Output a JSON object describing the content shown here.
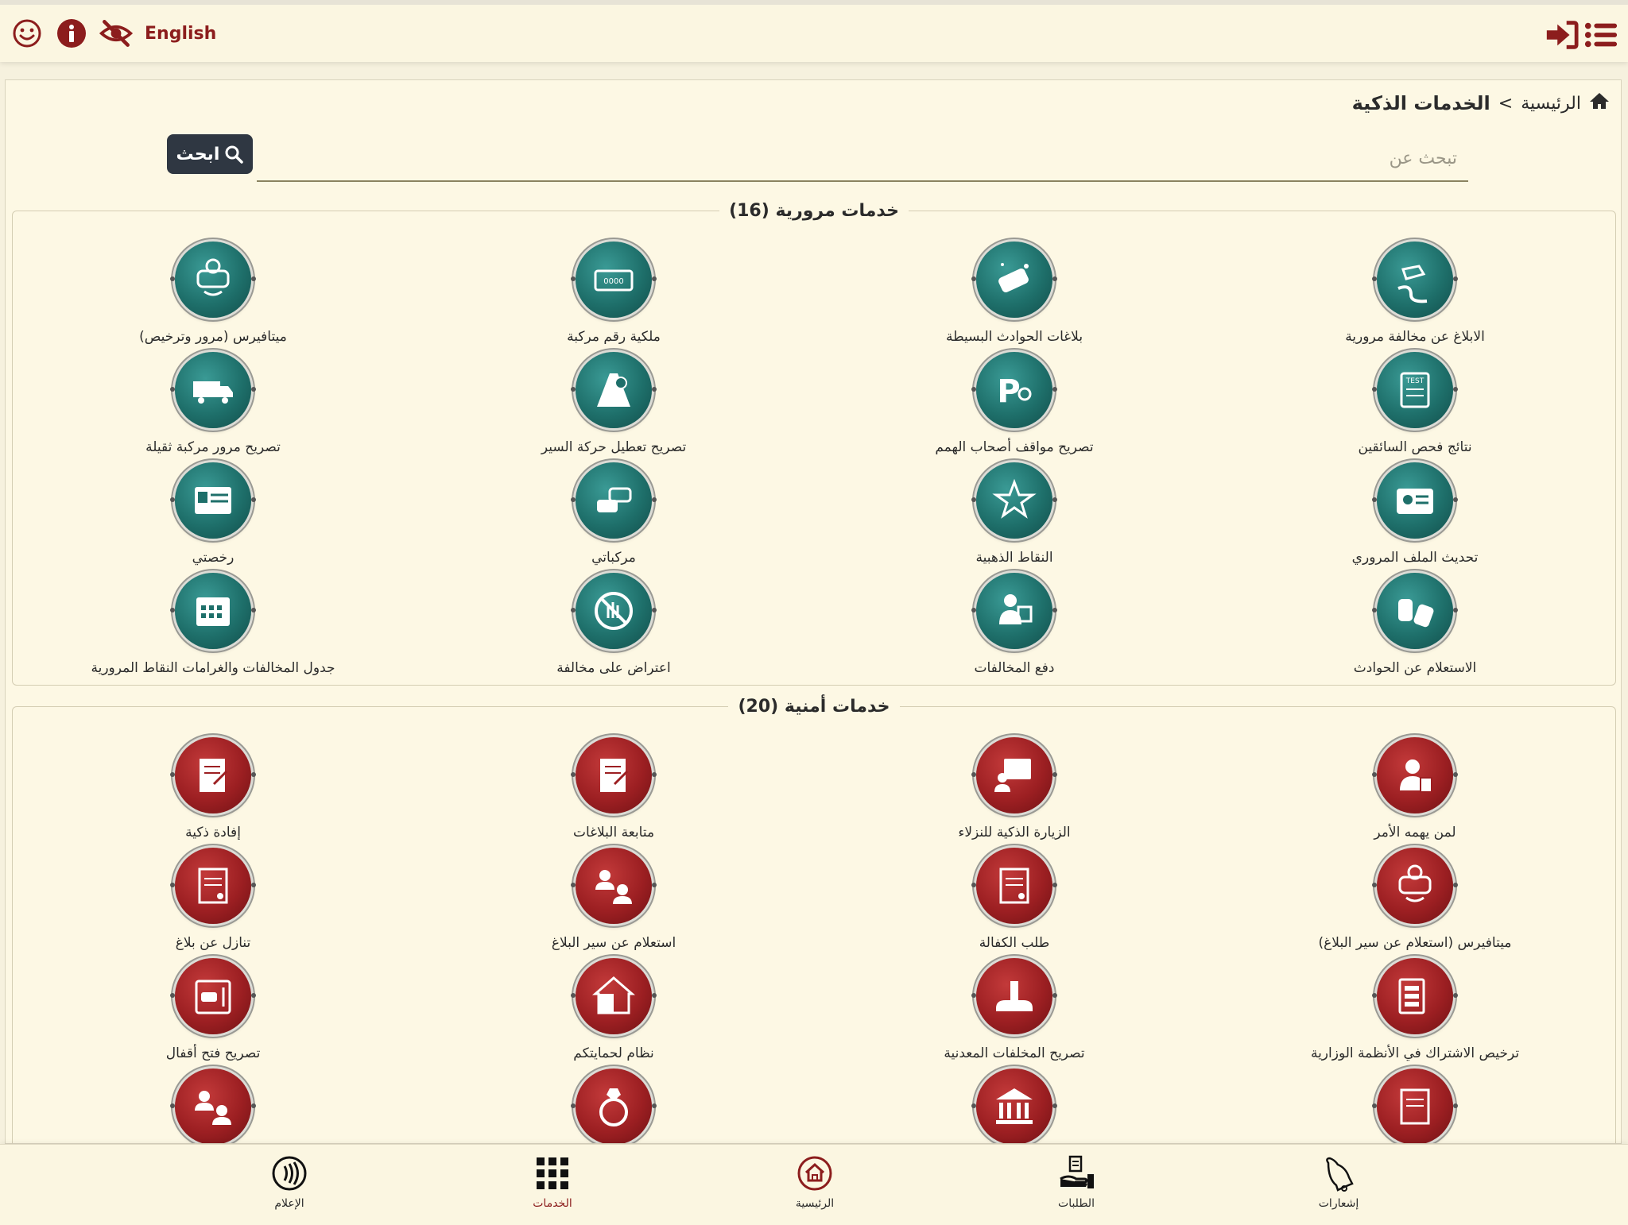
{
  "topbar": {
    "language_label": "English",
    "icons": [
      "smiley-icon",
      "info-icon",
      "eye-slash-icon",
      "logout-icon",
      "menu-icon"
    ]
  },
  "breadcrumb": {
    "home_label": "الرئيسية",
    "separator": ">",
    "current_label": "الخدمات الذكية"
  },
  "search": {
    "placeholder": "تبحث عن",
    "button_label": "ابحث"
  },
  "sections": [
    {
      "title": "خدمات مرورية (16)",
      "color": "#1e6f6a",
      "items": [
        {
          "label": "الابلاغ عن مخالفة مرورية",
          "icon": "car-swerve-icon"
        },
        {
          "label": "بلاغات الحوادث البسيطة",
          "icon": "car-crash-icon"
        },
        {
          "label": "ملكية رقم مركبة",
          "icon": "license-plate-icon"
        },
        {
          "label": "ميتافيرس (مرور وترخيص)",
          "icon": "vr-headset-icon"
        },
        {
          "label": "نتائج فحص السائقين",
          "icon": "test-sheet-icon"
        },
        {
          "label": "تصريح مواقف أصحاب الهمم",
          "icon": "accessible-parking-icon"
        },
        {
          "label": "تصريح تعطيل حركة السير",
          "icon": "road-block-icon"
        },
        {
          "label": "تصريح مرور مركبة ثقيلة",
          "icon": "truck-icon"
        },
        {
          "label": "تحديث الملف المروري",
          "icon": "id-card-icon"
        },
        {
          "label": "النقاط الذهبية",
          "icon": "star-badge-icon"
        },
        {
          "label": "مركباتي",
          "icon": "cars-icon"
        },
        {
          "label": "رخصتي",
          "icon": "driving-license-icon"
        },
        {
          "label": "الاستعلام عن الحوادث",
          "icon": "accident-inquiry-icon"
        },
        {
          "label": "دفع المخالفات",
          "icon": "officer-payment-icon"
        },
        {
          "label": "اعتراض على مخالفة",
          "icon": "objection-hand-icon"
        },
        {
          "label": "جدول المخالفات والغرامات النقاط المرورية",
          "icon": "calendar-table-icon"
        }
      ]
    },
    {
      "title": "خدمات أمنية (20)",
      "color": "#9c1f22",
      "items": [
        {
          "label": "لمن يهمه الأمر",
          "icon": "person-document-icon"
        },
        {
          "label": "الزيارة الذكية للنزلاء",
          "icon": "video-visit-icon"
        },
        {
          "label": "متابعة البلاغات",
          "icon": "report-followup-icon"
        },
        {
          "label": "إفادة ذكية",
          "icon": "statement-icon"
        },
        {
          "label": "ميتافيرس (استعلام عن سير البلاغ)",
          "icon": "vr-headset-icon"
        },
        {
          "label": "طلب الكفالة",
          "icon": "bail-document-icon"
        },
        {
          "label": "استعلام عن سير البلاغ",
          "icon": "people-exchange-icon"
        },
        {
          "label": "تنازل عن بلاغ",
          "icon": "waiver-document-icon"
        },
        {
          "label": "ترخيص الاشتراك في الأنظمة الوزارية",
          "icon": "systems-license-icon"
        },
        {
          "label": "تصريح المخلفات المعدنية",
          "icon": "scrap-metal-icon"
        },
        {
          "label": "نظام لحمايتكم",
          "icon": "home-shield-icon"
        },
        {
          "label": "تصريح فتح أقفال",
          "icon": "safe-lock-icon"
        },
        {
          "label": "",
          "icon": "document-icon"
        },
        {
          "label": "",
          "icon": "bank-icon"
        },
        {
          "label": "",
          "icon": "ring-icon"
        },
        {
          "label": "",
          "icon": "people-exchange-icon"
        }
      ]
    }
  ],
  "bottom_nav": [
    {
      "label": "الإعلام",
      "icon": "broadcast-icon"
    },
    {
      "label": "الخدمات",
      "icon": "grid-icon",
      "active": true
    },
    {
      "label": "الرئيسية",
      "icon": "home-icon"
    },
    {
      "label": "الطلبات",
      "icon": "hand-request-icon"
    },
    {
      "label": "إشعارات",
      "icon": "bell-icon"
    }
  ],
  "colors": {
    "accent": "#8c1d1d",
    "teal": "#1e6f6a",
    "red": "#9c1f22",
    "button_dark": "#2f3742",
    "background": "#fdf8e4"
  }
}
